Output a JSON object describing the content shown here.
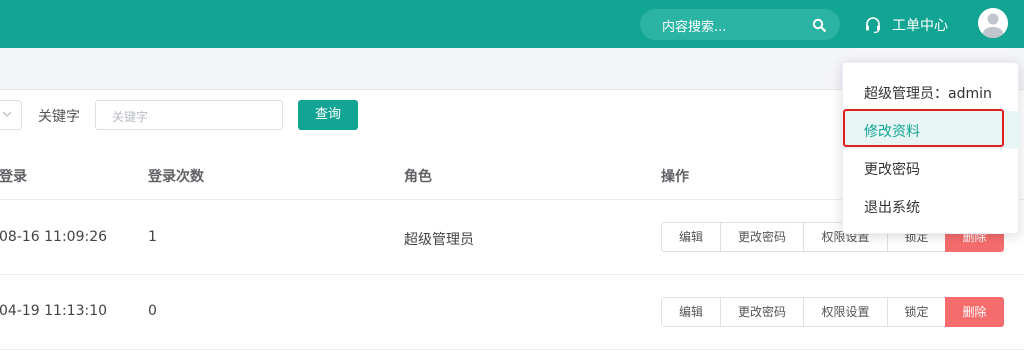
{
  "header": {
    "search_placeholder": "内容搜索...",
    "work_order_label": "工单中心",
    "icons": {
      "search": "search-icon",
      "support": "headset-icon",
      "user": "avatar-icon"
    },
    "color": "#12a593"
  },
  "filter": {
    "keyword_label": "关键字",
    "keyword_placeholder": "关键字",
    "query_button": "查询"
  },
  "table": {
    "columns": [
      "登录",
      "登录次数",
      "角色",
      "操作"
    ],
    "rows": [
      {
        "last_login": "08-16 11:09:26",
        "login_count": "1",
        "role": "超级管理员",
        "actions": [
          "编辑",
          "更改密码",
          "权限设置",
          "锁定",
          "删除"
        ]
      },
      {
        "last_login": "04-19 11:13:10",
        "login_count": "0",
        "role": "",
        "actions": [
          "编辑",
          "更改密码",
          "权限设置",
          "锁定",
          "删除"
        ]
      }
    ]
  },
  "user_menu": {
    "title": "超级管理员：admin",
    "items": [
      "修改资料",
      "更改密码",
      "退出系统"
    ],
    "highlighted": "修改资料"
  }
}
